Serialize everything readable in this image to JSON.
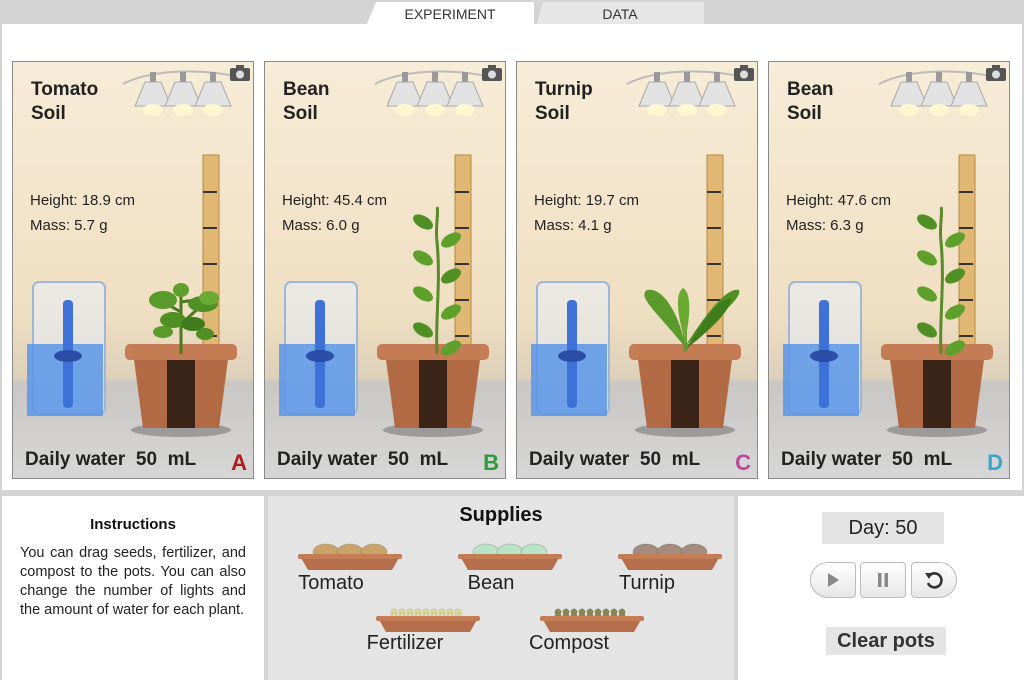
{
  "tabs": [
    {
      "label": "EXPERIMENT",
      "active": true
    },
    {
      "label": "DATA",
      "active": false
    }
  ],
  "pots": [
    {
      "id": "A",
      "title_line1": "Tomato",
      "title_line2": "Soil",
      "height": "Height: 18.9 cm",
      "mass": "Mass: 5.7 g",
      "water_label": "Daily water",
      "water_value": "50",
      "water_unit": "mL",
      "letter_color": "#b01c1c",
      "plant": "tomato"
    },
    {
      "id": "B",
      "title_line1": "Bean",
      "title_line2": "Soil",
      "height": "Height: 45.4 cm",
      "mass": "Mass: 6.0 g",
      "water_label": "Daily water",
      "water_value": "50",
      "water_unit": "mL",
      "letter_color": "#2f9a3a",
      "plant": "bean"
    },
    {
      "id": "C",
      "title_line1": "Turnip",
      "title_line2": "Soil",
      "height": "Height: 19.7 cm",
      "mass": "Mass: 4.1 g",
      "water_label": "Daily water",
      "water_value": "50",
      "water_unit": "mL",
      "letter_color": "#c0449a",
      "plant": "turnip"
    },
    {
      "id": "D",
      "title_line1": "Bean",
      "title_line2": "Soil",
      "height": "Height: 47.6 cm",
      "mass": "Mass: 6.3 g",
      "water_label": "Daily water",
      "water_value": "50",
      "water_unit": "mL",
      "letter_color": "#3aa6c9",
      "plant": "bean"
    }
  ],
  "instructions": {
    "title": "Instructions",
    "text": "You can drag seeds, fertilizer, and compost to the pots. You can also change the number of lights and the amount of water for each plant."
  },
  "supplies": {
    "title": "Supplies",
    "items": [
      {
        "label": "Tomato",
        "seed_color": "#c9a46a"
      },
      {
        "label": "Bean",
        "seed_color": "#b8e3c4"
      },
      {
        "label": "Turnip",
        "seed_color": "#a38b7e"
      },
      {
        "label": "Fertilizer",
        "seed_color": "#e2d89a"
      },
      {
        "label": "Compost",
        "seed_color": "#8b8a55"
      }
    ]
  },
  "controls": {
    "day": "Day: 50",
    "play_icon": "play-icon",
    "pause_icon": "pause-icon",
    "reset_icon": "reset-icon",
    "clear_label": "Clear pots"
  }
}
